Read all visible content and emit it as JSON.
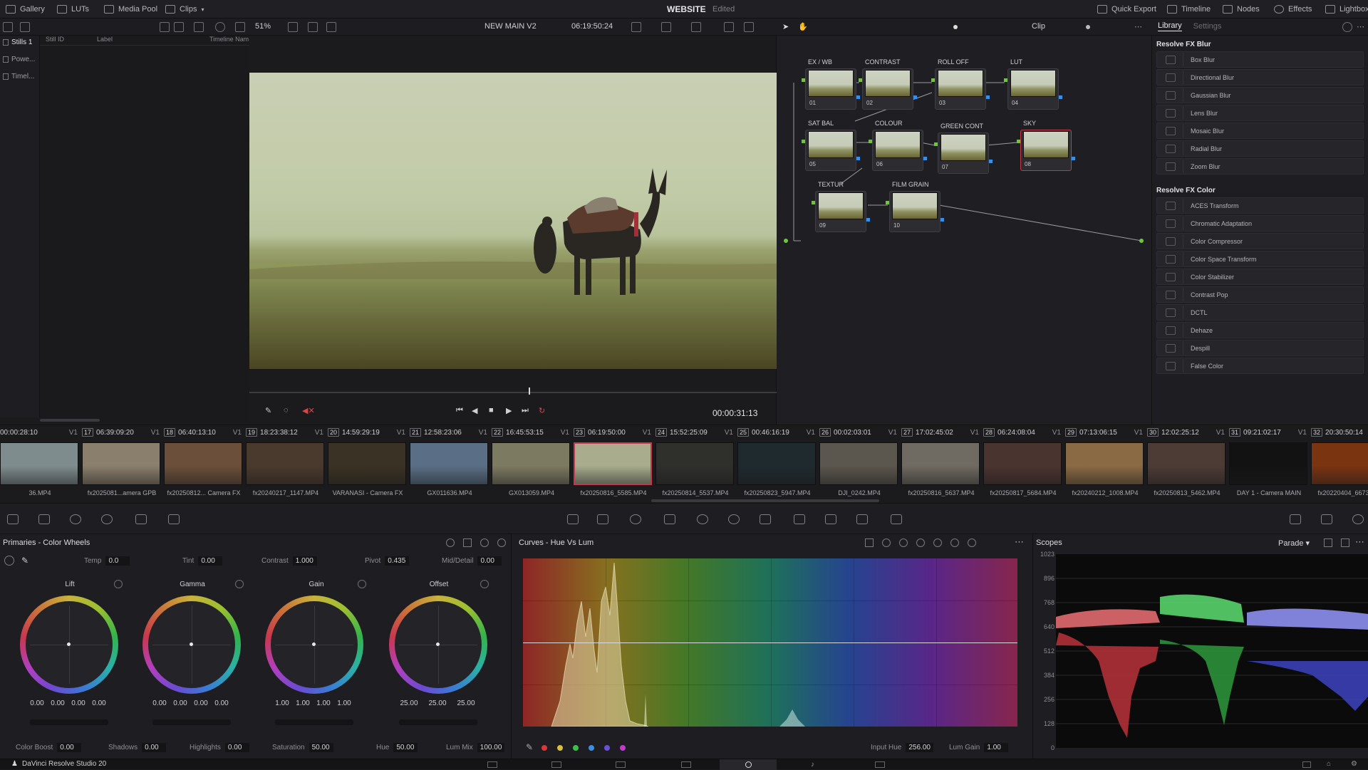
{
  "topbar": {
    "tabs": [
      {
        "label": "Gallery",
        "icon": "gallery-icon"
      },
      {
        "label": "LUTs",
        "icon": "luts-icon"
      },
      {
        "label": "Media Pool",
        "icon": "media-pool-icon"
      },
      {
        "label": "Clips",
        "icon": "clips-icon"
      }
    ],
    "project": "WEBSITE",
    "project_status": "Edited",
    "right": [
      {
        "label": "Quick Export",
        "icon": "quick-export-icon"
      },
      {
        "label": "Timeline",
        "icon": "timeline-icon"
      },
      {
        "label": "Nodes",
        "icon": "nodes-icon"
      },
      {
        "label": "Effects",
        "icon": "effects-icon"
      },
      {
        "label": "Lightbox",
        "icon": "lightbox-icon"
      }
    ]
  },
  "toolbar": {
    "zoom": "51%",
    "timeline_name": "NEW MAIN V2",
    "timecode": "06:19:50:24",
    "mode": "Clip"
  },
  "leftnav": {
    "items": [
      "Stills 1",
      "Powe...",
      "Timel..."
    ]
  },
  "stills": {
    "columns": [
      "Still ID",
      "Label",
      "Timeline Nam"
    ]
  },
  "viewer": {
    "timecode": "00:00:31:13",
    "playhead_fraction": 0.53
  },
  "nodes": [
    {
      "label": "EX / WB",
      "num": "01"
    },
    {
      "label": "CONTRAST",
      "num": "02"
    },
    {
      "label": "ROLL OFF",
      "num": "03"
    },
    {
      "label": "LUT",
      "num": "04"
    },
    {
      "label": "SAT BAL",
      "num": "05"
    },
    {
      "label": "COLOUR",
      "num": "06"
    },
    {
      "label": "GREEN CONT",
      "num": "07"
    },
    {
      "label": "SKY",
      "num": "08"
    },
    {
      "label": "TEXTUR",
      "num": "09"
    },
    {
      "label": "FILM GRAIN",
      "num": "10"
    }
  ],
  "library": {
    "tabs": [
      "Library",
      "Settings"
    ],
    "sections": [
      {
        "title": "Resolve FX Blur",
        "items": [
          "Box Blur",
          "Directional Blur",
          "Gaussian Blur",
          "Lens Blur",
          "Mosaic Blur",
          "Radial Blur",
          "Zoom Blur"
        ]
      },
      {
        "title": "Resolve FX Color",
        "items": [
          "ACES Transform",
          "Chromatic Adaptation",
          "Color Compressor",
          "Color Space Transform",
          "Color Stabilizer",
          "Contrast Pop",
          "DCTL",
          "Dehaze",
          "Despill",
          "False Color"
        ]
      }
    ]
  },
  "clips": [
    {
      "tc": "00:00:28:10",
      "badge": "",
      "track": "V1",
      "name": "36.MP4",
      "color": "#7f8c8e"
    },
    {
      "tc": "06:39:09:20",
      "badge": "17",
      "track": "V1",
      "name": "fx2025081...amera GPB",
      "color": "#8a7f6d"
    },
    {
      "tc": "06:40:13:10",
      "badge": "18",
      "track": "V1",
      "name": "fx20250812... Camera FX",
      "color": "#6b4f3a"
    },
    {
      "tc": "18:23:38:12",
      "badge": "19",
      "track": "V1",
      "name": "fx20240217_1147.MP4",
      "color": "#4a3a2e"
    },
    {
      "tc": "14:59:29:19",
      "badge": "20",
      "track": "V1",
      "name": "VARANASI - Camera FX",
      "color": "#3a3224"
    },
    {
      "tc": "12:58:23:06",
      "badge": "21",
      "track": "V1",
      "name": "GX011636.MP4",
      "color": "#5a6f86"
    },
    {
      "tc": "16:45:53:15",
      "badge": "22",
      "track": "V1",
      "name": "GX013059.MP4",
      "color": "#7d7a62"
    },
    {
      "tc": "06:19:50:00",
      "badge": "23",
      "track": "V1",
      "name": "fx20250816_5585.MP4",
      "color": "#a9ad8e"
    },
    {
      "tc": "15:52:25:09",
      "badge": "24",
      "track": "V1",
      "name": "fx20250814_5537.MP4",
      "color": "#2f2f2c"
    },
    {
      "tc": "00:46:16:19",
      "badge": "25",
      "track": "V1",
      "name": "fx20250823_5947.MP4",
      "color": "#1f2a2e"
    },
    {
      "tc": "00:02:03:01",
      "badge": "26",
      "track": "V1",
      "name": "DJI_0242.MP4",
      "color": "#5b564e"
    },
    {
      "tc": "17:02:45:02",
      "badge": "27",
      "track": "V1",
      "name": "fx20250816_5637.MP4",
      "color": "#6f6a62"
    },
    {
      "tc": "06:24:08:04",
      "badge": "28",
      "track": "V1",
      "name": "fx20250817_5684.MP4",
      "color": "#4a3430"
    },
    {
      "tc": "07:13:06:15",
      "badge": "29",
      "track": "V1",
      "name": "fx20240212_1008.MP4",
      "color": "#8a6a44"
    },
    {
      "tc": "12:02:25:12",
      "badge": "30",
      "track": "V1",
      "name": "fx20250813_5462.MP4",
      "color": "#4d3b36"
    },
    {
      "tc": "09:21:02:17",
      "badge": "31",
      "track": "V1",
      "name": "DAY 1 - Camera MAIN",
      "color": "#121212"
    },
    {
      "tc": "20:30:50:14",
      "badge": "32",
      "track": "",
      "name": "fx20220404_6673.MP4",
      "color": "#7a3410"
    }
  ],
  "primaries": {
    "title": "Primaries - Color Wheels",
    "fields": [
      {
        "label": "Temp",
        "value": "0.0"
      },
      {
        "label": "Tint",
        "value": "0.00"
      },
      {
        "label": "Contrast",
        "value": "1.000"
      },
      {
        "label": "Pivot",
        "value": "0.435"
      },
      {
        "label": "Mid/Detail",
        "value": "0.00"
      }
    ],
    "wheels": [
      {
        "label": "Lift",
        "values": [
          "0.00",
          "0.00",
          "0.00",
          "0.00"
        ]
      },
      {
        "label": "Gamma",
        "values": [
          "0.00",
          "0.00",
          "0.00",
          "0.00"
        ]
      },
      {
        "label": "Gain",
        "values": [
          "1.00",
          "1.00",
          "1.00",
          "1.00"
        ]
      },
      {
        "label": "Offset",
        "values": [
          "25.00",
          "25.00",
          "25.00"
        ]
      }
    ],
    "bottom": [
      {
        "label": "Color Boost",
        "value": "0.00"
      },
      {
        "label": "Shadows",
        "value": "0.00"
      },
      {
        "label": "Highlights",
        "value": "0.00"
      },
      {
        "label": "Saturation",
        "value": "50.00"
      },
      {
        "label": "Hue",
        "value": "50.00"
      },
      {
        "label": "Lum Mix",
        "value": "100.00"
      }
    ]
  },
  "curves": {
    "title": "Curves - Hue Vs Lum",
    "input_hue_label": "Input Hue",
    "input_hue": "256.00",
    "lum_gain_label": "Lum Gain",
    "lum_gain": "1.00",
    "swatches": [
      "#d93838",
      "#d8c03a",
      "#3cc04a",
      "#3a8ee3",
      "#6a4fd8",
      "#c23bd0"
    ]
  },
  "scopes": {
    "title": "Scopes",
    "mode": "Parade",
    "y_ticks": [
      "1023",
      "896",
      "768",
      "640",
      "512",
      "384",
      "256",
      "128",
      "0"
    ]
  },
  "status": {
    "app": "DaVinci Resolve Studio 20"
  }
}
